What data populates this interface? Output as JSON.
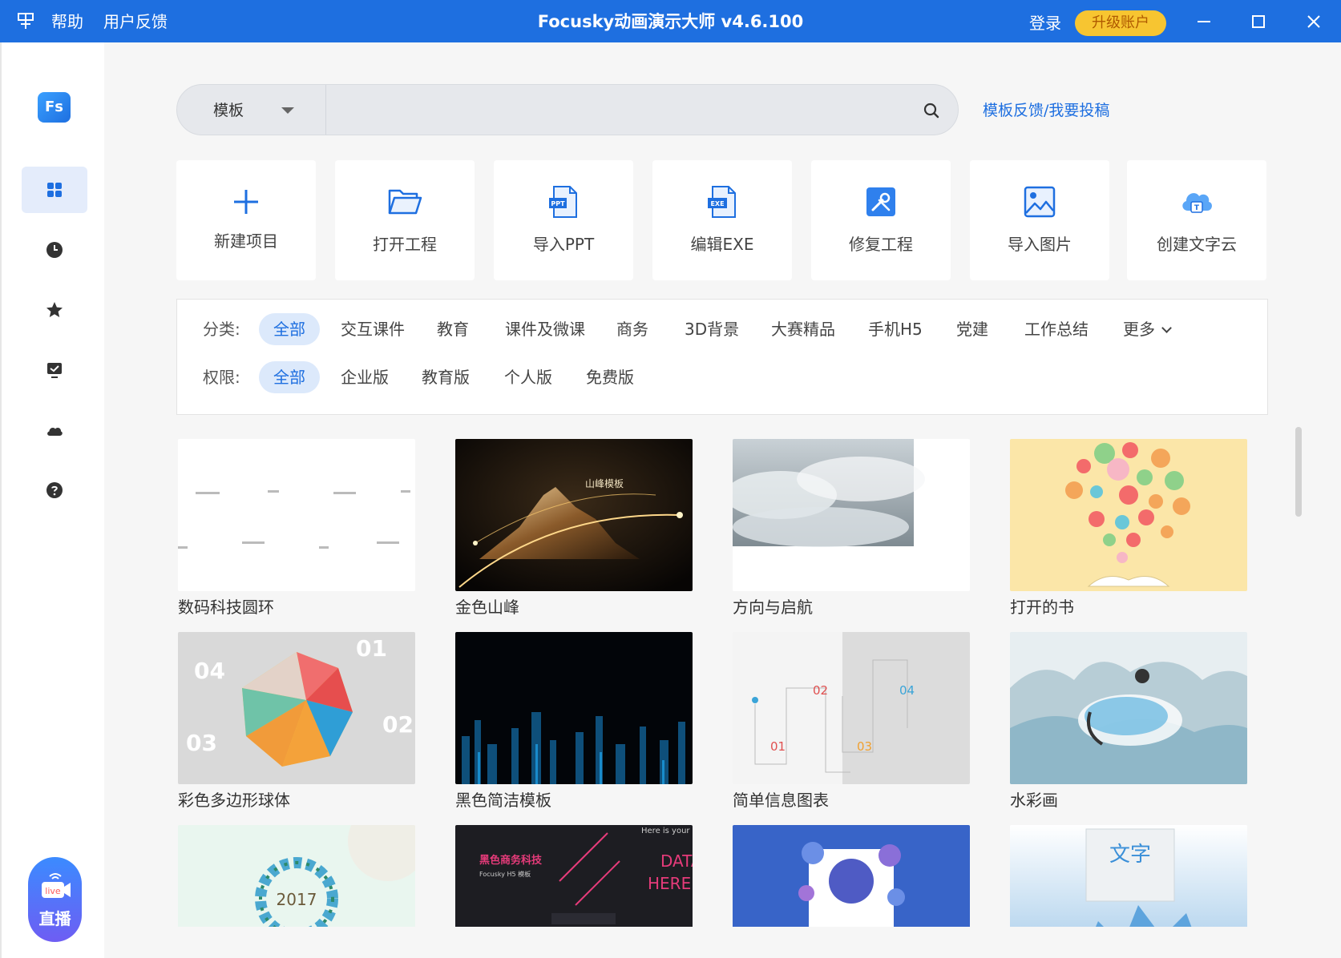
{
  "titlebar": {
    "menu_icon": "menu-icon",
    "help": "帮助",
    "feedback": "用户反馈",
    "app_title": "Focusky动画演示大师 v4.6.100",
    "login": "登录",
    "upgrade": "升级账户",
    "accent_color": "#1e6fe0",
    "upgrade_color": "#f7c531"
  },
  "sidebar": {
    "logo": "Fs",
    "items": [
      {
        "icon": "grid-icon",
        "active": true
      },
      {
        "icon": "clock-icon",
        "active": false
      },
      {
        "icon": "star-icon",
        "active": false
      },
      {
        "icon": "presentation-check-icon",
        "active": false
      },
      {
        "icon": "cloud-icon",
        "active": false
      },
      {
        "icon": "help-icon",
        "active": false
      }
    ],
    "live": {
      "badge": "live",
      "label": "直播"
    }
  },
  "search": {
    "type_label": "模板",
    "placeholder": "",
    "value": "",
    "feedback_link": "模板反馈/我要投稿"
  },
  "actions": [
    {
      "label": "新建项目",
      "icon": "plus-icon"
    },
    {
      "label": "打开工程",
      "icon": "folder-open-icon"
    },
    {
      "label": "导入PPT",
      "icon": "ppt-file-icon",
      "badge": "PPT"
    },
    {
      "label": "编辑EXE",
      "icon": "exe-file-icon",
      "badge": "EXE"
    },
    {
      "label": "修复工程",
      "icon": "repair-tools-icon"
    },
    {
      "label": "导入图片",
      "icon": "image-icon"
    },
    {
      "label": "创建文字云",
      "icon": "text-cloud-icon",
      "badge": "T"
    }
  ],
  "filters": {
    "category_label": "分类:",
    "categories": [
      "全部",
      "交互课件",
      "教育",
      "课件及微课",
      "商务",
      "3D背景",
      "大赛精品",
      "手机H5",
      "党建",
      "工作总结",
      "更多"
    ],
    "category_selected": "全部",
    "permission_label": "权限:",
    "permissions": [
      "全部",
      "企业版",
      "教育版",
      "个人版",
      "免费版"
    ],
    "permission_selected": "全部"
  },
  "templates": [
    {
      "title": "数码科技圆环"
    },
    {
      "title": "金色山峰",
      "thumb_text": "山峰模板"
    },
    {
      "title": "方向与启航"
    },
    {
      "title": "打开的书"
    },
    {
      "title": "彩色多边形球体",
      "thumb_numbers": [
        "01",
        "02",
        "03",
        "04"
      ]
    },
    {
      "title": "黑色简洁模板"
    },
    {
      "title": "简单信息图表",
      "thumb_numbers": [
        "01",
        "02",
        "03",
        "04"
      ]
    },
    {
      "title": "水彩画"
    },
    {
      "title": "",
      "thumb_text": "2017"
    },
    {
      "title": "",
      "thumb_text_lines": [
        "黑色商务科技",
        "Focusky H5 模板",
        "Here is your",
        "DATA",
        "HERE"
      ]
    },
    {
      "title": ""
    },
    {
      "title": "",
      "thumb_text": "文字"
    }
  ]
}
